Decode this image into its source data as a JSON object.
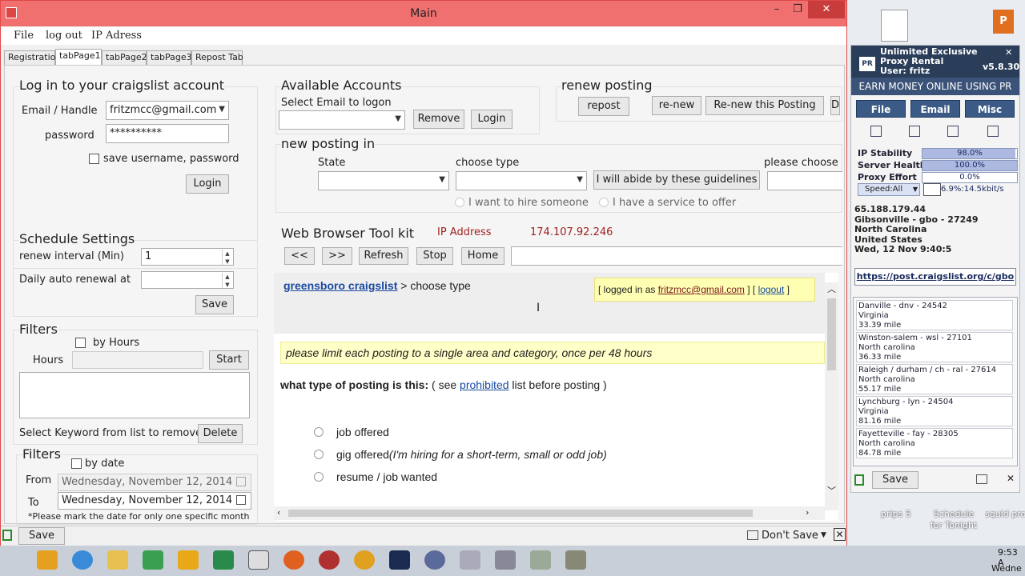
{
  "window": {
    "title": "Main",
    "minimize": "–",
    "restore": "❐",
    "close": "✕"
  },
  "menu": [
    "File",
    "log out",
    "IP Adress"
  ],
  "tabs": [
    "Registration",
    "tabPage1",
    "tabPage2",
    "tabPage3",
    "Repost Tab"
  ],
  "login": {
    "title": "Log in to your craigslist account",
    "email_label": "Email / Handle",
    "email_value": "fritzmcc@gmail.com",
    "password_label": "password",
    "password_value": "**********",
    "save_label": "save username, password",
    "login_button": "Login"
  },
  "accounts": {
    "title": "Available Accounts",
    "select_label": "Select Email to  logon",
    "remove_button": "Remove",
    "login_button": "Login"
  },
  "renew": {
    "title": "renew posting",
    "repost_button": "repost",
    "renew_button": "re-new",
    "renew_this_button": "Re-new this Posting",
    "extra_button": "D"
  },
  "newposting": {
    "title": "new posting in",
    "state_label": "State",
    "type_label": "choose type",
    "abide_button": "I will abide by these guidelines",
    "please_choose": "please choose",
    "hire_label": "I want to hire someone",
    "service_label": "I have a service to offer"
  },
  "schedule": {
    "title": "Schedule Settings",
    "interval_label": "renew interval (Min)",
    "interval_value": "1",
    "daily_label": "Daily auto renewal at",
    "save_button": "Save"
  },
  "filters1": {
    "title": "Filters",
    "by_hours": "by Hours",
    "hours_label": "Hours",
    "start_button": "Start",
    "keyword_label": "Select Keyword from list to remove",
    "delete_button": "Delete"
  },
  "filters2": {
    "title": "Filters",
    "by_date": "by date",
    "from_label": "From",
    "from_value": "Wednesday, November 12, 2014",
    "to_label": "To",
    "to_value": "Wednesday, November 12, 2014",
    "note": "*Please mark the date for only one specific month"
  },
  "toolkit": {
    "title": "Web Browser Tool kit",
    "ip_label": "IP Address",
    "ip_value": "174.107.92.246",
    "back_button": "<<",
    "forward_button": ">>",
    "refresh_button": "Refresh",
    "stop_button": "Stop",
    "home_button": "Home"
  },
  "web": {
    "site_link": "greensboro craigslist",
    "crumb": " > choose type",
    "logged_prefix": "[ logged in as ",
    "logged_user": "fritzmcc@gmail.com",
    "logged_mid": " ] [ ",
    "logout": "logout",
    "logged_suffix": " ]",
    "notice": "please limit each posting to a single area and category, once per 48 hours",
    "question": "what type of posting is this:",
    "see_pre": " ( see ",
    "prohibited": "prohibited",
    "see_post": " list before posting )",
    "options": [
      {
        "label": "job offered",
        "note": ""
      },
      {
        "label": "gig offered",
        "note": "(I'm hiring for a short-term, small or odd job)"
      },
      {
        "label": "resume / job wanted",
        "note": ""
      }
    ]
  },
  "status": {
    "save_button": "Save",
    "dont_save": "Don't Save"
  },
  "proxy": {
    "line1": "Unlimited Exclusive",
    "line2": "Proxy Rental",
    "line3": "User: fritz",
    "version": "v5.8.30",
    "banner": "EARN MONEY ONLINE USING PR",
    "buttons": [
      "File",
      "Email",
      "Misc"
    ],
    "stability_label": "IP Stability",
    "stability_value": "98.0%",
    "stability_fraction": 0.98,
    "health_label": "Server Health",
    "health_value": "100.0%",
    "health_fraction": 1.0,
    "effort_label": "Proxy Effort",
    "effort_value": "0.0%",
    "speed_label": "Speed:All",
    "speed_value": "6.9%:14.5kbit/s",
    "ip": "65.188.179.44",
    "location": "Gibsonville - gbo - 27249",
    "state": "North Carolina",
    "country": "United States",
    "time": "Wed, 12 Nov 9:40:5",
    "url": "https://post.craigslist.org/c/gbo",
    "cities": [
      {
        "name": "Danville - dnv - 24542",
        "state": "Virginia",
        "dist": "33.39 mile"
      },
      {
        "name": "Winston-salem - wsl - 27101",
        "state": "North carolina",
        "dist": "36.33 mile"
      },
      {
        "name": "Raleigh / durham / ch - ral - 27614",
        "state": "North carolina",
        "dist": "55.17 mile"
      },
      {
        "name": "Lynchburg - lyn - 24504",
        "state": "Virginia",
        "dist": "81.16 mile"
      },
      {
        "name": "Fayetteville - fay - 28305",
        "state": "North carolina",
        "dist": "84.78 mile"
      }
    ],
    "save_button": "Save"
  },
  "desktop": {
    "icon1": "prips 5",
    "icon2": "Schedule for Tonight",
    "icon3": "squid pro"
  },
  "clock": {
    "time": "9:53 A",
    "day": "Wedne"
  }
}
